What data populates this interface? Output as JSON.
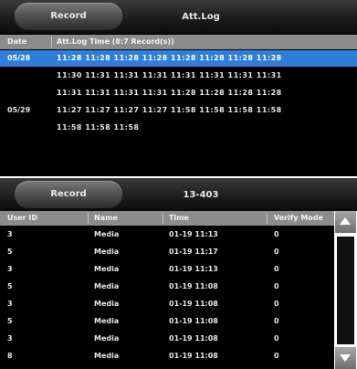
{
  "top_panel": {
    "tab_label": "Record",
    "title": "Att.Log",
    "header": {
      "date": "Date",
      "times": "Att.Log Time (8:7 Record(s))"
    },
    "rows": [
      {
        "date": "05/28",
        "times": "11:28 11:28 11:28 11:28 11:28 11:28 11:28 11:28"
      },
      {
        "date": "",
        "times": "11:30 11:31 11:31 11:31 11:31 11:31 11:31 11:31"
      },
      {
        "date": "",
        "times": "11:31 11:31 11:31 11:31 11:28 11:28 11:28 11:28"
      },
      {
        "date": "05/29",
        "times": "11:27 11:27 11:27 11:27 11:58 11:58 11:58 11:58"
      },
      {
        "date": "",
        "times": "11:58 11:58 11:58"
      }
    ],
    "selected_row": 0
  },
  "bottom_panel": {
    "tab_label": "Record",
    "title": "13-403",
    "header": {
      "user_id": "User ID",
      "name": "Name",
      "time": "Time",
      "verify_mode": "Verify Mode"
    },
    "rows": [
      {
        "user_id": "3",
        "name": "Media",
        "time": "01-19 11:13",
        "mode": "0"
      },
      {
        "user_id": "5",
        "name": "Media",
        "time": "01-19 11:17",
        "mode": "0"
      },
      {
        "user_id": "3",
        "name": "Media",
        "time": "01-19 11:13",
        "mode": "0"
      },
      {
        "user_id": "5",
        "name": "Media",
        "time": "01-19 11:08",
        "mode": "0"
      },
      {
        "user_id": "3",
        "name": "Media",
        "time": "01-19 11:08",
        "mode": "0"
      },
      {
        "user_id": "5",
        "name": "Media",
        "time": "01-19 11:08",
        "mode": "0"
      },
      {
        "user_id": "3",
        "name": "Media",
        "time": "01-19 11:08",
        "mode": "0"
      },
      {
        "user_id": "8",
        "name": "Media",
        "time": "01-19 11:08",
        "mode": "0"
      }
    ]
  },
  "icons": {
    "scroll_up": "arrow-up-icon",
    "scroll_down": "arrow-down-icon"
  }
}
